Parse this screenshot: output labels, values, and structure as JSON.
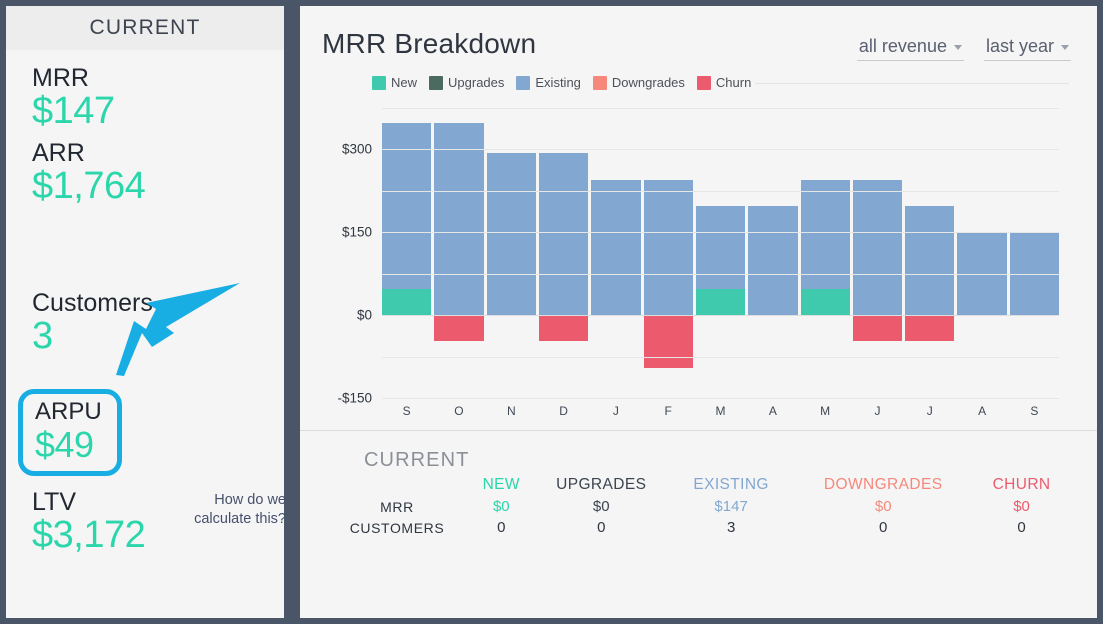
{
  "sidebar": {
    "header": "CURRENT",
    "metrics": [
      {
        "label": "MRR",
        "value": "$147",
        "name": "mrr"
      },
      {
        "label": "ARR",
        "value": "$1,764",
        "name": "arr"
      },
      {
        "label": "Customers",
        "value": "3",
        "name": "customers"
      },
      {
        "label": "ARPU",
        "value": "$49",
        "name": "arpu"
      },
      {
        "label": "LTV",
        "value": "$3,172",
        "name": "ltv"
      }
    ],
    "calculate_link": "How do we calculate this?",
    "highlight_color": "#18ade3",
    "value_color": "#2bd6ab"
  },
  "chart_header": {
    "title": "MRR Breakdown",
    "revenue_filter": "all revenue",
    "period_filter": "last year"
  },
  "chart_data": {
    "type": "bar",
    "title": "MRR Breakdown",
    "xlabel": "",
    "ylabel": "",
    "ylim": [
      -150,
      375
    ],
    "yticks": [
      "$300",
      "$150",
      "$0",
      "-$150"
    ],
    "ytick_values": [
      300,
      150,
      0,
      -150
    ],
    "grid": true,
    "stacked": true,
    "legend_position": "top-left",
    "categories": [
      "S",
      "O",
      "N",
      "D",
      "J",
      "F",
      "M",
      "A",
      "M",
      "J",
      "J",
      "A",
      "S"
    ],
    "series": [
      {
        "name": "New",
        "color": "#3fc9ad",
        "values": [
          47,
          0,
          0,
          0,
          0,
          0,
          47,
          0,
          47,
          0,
          0,
          0,
          0
        ]
      },
      {
        "name": "Upgrades",
        "color": "#4b6b60",
        "values": [
          0,
          0,
          0,
          0,
          0,
          0,
          0,
          0,
          0,
          0,
          0,
          0,
          0
        ]
      },
      {
        "name": "Existing",
        "color": "#82a8d1",
        "values": [
          300,
          347,
          293,
          293,
          245,
          245,
          150,
          197,
          197,
          245,
          197,
          150,
          150
        ]
      },
      {
        "name": "Downgrades",
        "color": "#f6887b",
        "values": [
          0,
          0,
          0,
          0,
          0,
          0,
          0,
          0,
          0,
          0,
          0,
          0,
          0
        ]
      },
      {
        "name": "Churn",
        "color": "#ec5a6e",
        "values": [
          0,
          -47,
          0,
          -47,
          0,
          -96,
          0,
          0,
          0,
          -47,
          -47,
          0,
          0
        ]
      }
    ]
  },
  "summary": {
    "title": "CURRENT",
    "columns": [
      {
        "label": "NEW",
        "color": "#2bd6ab"
      },
      {
        "label": "UPGRADES",
        "color": "#3c4450"
      },
      {
        "label": "EXISTING",
        "color": "#82a8d1"
      },
      {
        "label": "DOWNGRADES",
        "color": "#f6887b"
      },
      {
        "label": "CHURN",
        "color": "#ec5a6e"
      }
    ],
    "rows": [
      {
        "label": "MRR",
        "values": [
          "$0",
          "$0",
          "$147",
          "$0",
          "$0"
        ]
      },
      {
        "label": "CUSTOMERS",
        "values": [
          "0",
          "0",
          "3",
          "0",
          "0"
        ]
      }
    ]
  }
}
